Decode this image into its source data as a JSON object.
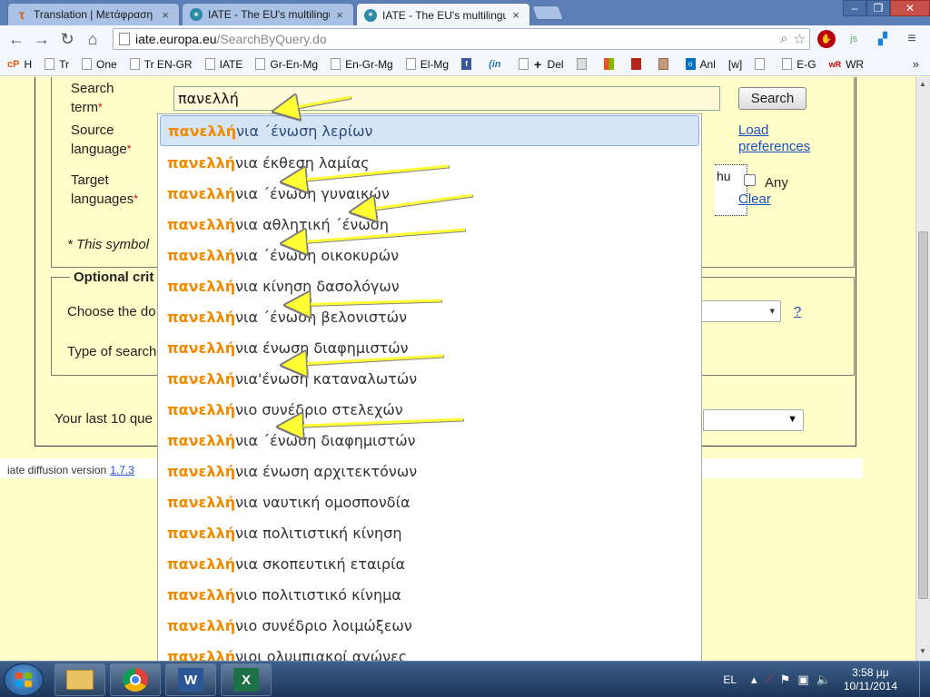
{
  "browser": {
    "tabs": [
      {
        "title": "Translation | Μετάφραση",
        "icon": "tau-icon"
      },
      {
        "title": "IATE - The EU's multilingu",
        "icon": "iate-icon"
      },
      {
        "title": "IATE - The EU's multilingu",
        "icon": "iate-icon",
        "active": true
      }
    ],
    "url_host": "iate.europa.eu",
    "url_path": "/SearchByQuery.do",
    "bookmarks": [
      "H",
      "Tr",
      "One",
      "Tr EN-GR",
      "IATE",
      "Gr-En-Mg",
      "En-Gr-Mg",
      "El-Mg",
      "",
      "",
      "Del",
      "",
      "",
      "",
      "",
      "Anl",
      "[w]",
      "",
      "E-G",
      "WR"
    ],
    "bookmarks_more": "»"
  },
  "form": {
    "search_term_label": "Search term",
    "search_term_value": "πανελλή",
    "source_language_label": "Source language",
    "target_languages_label": "Target languages",
    "required_mark": "*",
    "required_note": "* This symbol",
    "search_button": "Search",
    "load_preferences": "Load preferences",
    "target_box_text": "hu",
    "any_label": "Any",
    "clear_label": "Clear",
    "optional_legend": "Optional crit",
    "domain_label": "Choose the do",
    "search_type_label": "Type of search",
    "help_link": "?",
    "last_queries_label": "Your last 10 que"
  },
  "footer": {
    "version_text": "iate diffusion version",
    "version_number": "1.7.3"
  },
  "suggestions": {
    "prefix": "πανελλή",
    "items": [
      "νια ΄ένωση λερίων",
      "νια έκθεση λαμίας",
      "νια ΄ένωση γυναικών",
      "νια αθλητική ΄ένωση",
      "νια ΄ένωση οικοκυρών",
      "νια κίνηση δασολόγων",
      "νια ΄ένωση βελονιστών",
      "νια ένωση διαφημιστών",
      "νια'ένωση καταναλωτών",
      "νιο συνέδριο στελεχών",
      "νια ΄ένωση διαφημιστών",
      "νια ένωση αρχιτεκτόνων",
      "νια ναυτική ομοσπονδία",
      "νια πολιτιστική κίνηση",
      "νια σκοπευτική εταιρία",
      "νιο πολιτιστικό κίνημα",
      "νιο συνέδριο λοιμώξεων",
      "νιοι ολυμπιακοί αγώνες"
    ],
    "selected_index": 0
  },
  "taskbar": {
    "language": "EL",
    "time": "3:58 μμ",
    "date": "10/11/2014",
    "apps": [
      "explorer-icon",
      "chrome-icon",
      "word-icon",
      "excel-icon"
    ]
  },
  "colors": {
    "page_bg": "#fffdc8",
    "highlight": "#f08a00",
    "arrow": "#ffff33",
    "link": "#1a4fc8"
  }
}
